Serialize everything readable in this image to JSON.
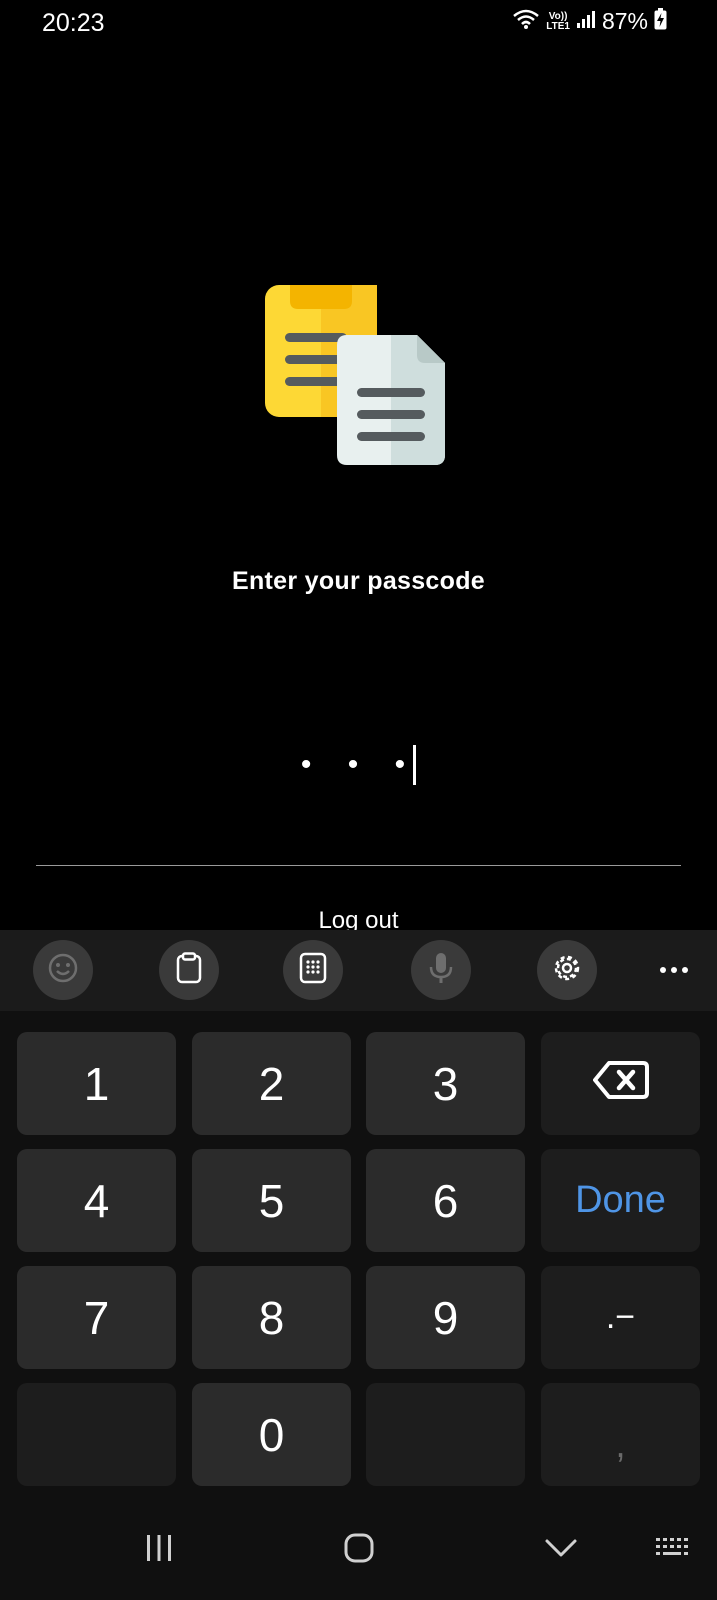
{
  "status_bar": {
    "time": "20:23",
    "battery": "87%",
    "network_label_top": "Vo))",
    "network_label_bottom": "LTE1"
  },
  "lock_screen": {
    "title": "Enter your passcode",
    "passcode_masked": "• • •",
    "logout_label": "Log out"
  },
  "keyboard_toolbar": {
    "icons": [
      "emoji-icon",
      "clipboard-icon",
      "keypad-icon",
      "microphone-icon",
      "settings-icon",
      "more-icon"
    ]
  },
  "keypad": {
    "k1": "1",
    "k2": "2",
    "k3": "3",
    "k4": "4",
    "k5": "5",
    "k6": "6",
    "k7": "7",
    "k8": "8",
    "k9": "9",
    "k0": "0",
    "done": "Done",
    "dot_dash": ".−",
    "comma": ","
  },
  "colors": {
    "background": "#000000",
    "keyboard": "#101010",
    "key": "#2b2b2b",
    "accent": "#4f95e6",
    "logo_yellow": "#fdd835",
    "logo_paper": "#e8f0ef"
  }
}
